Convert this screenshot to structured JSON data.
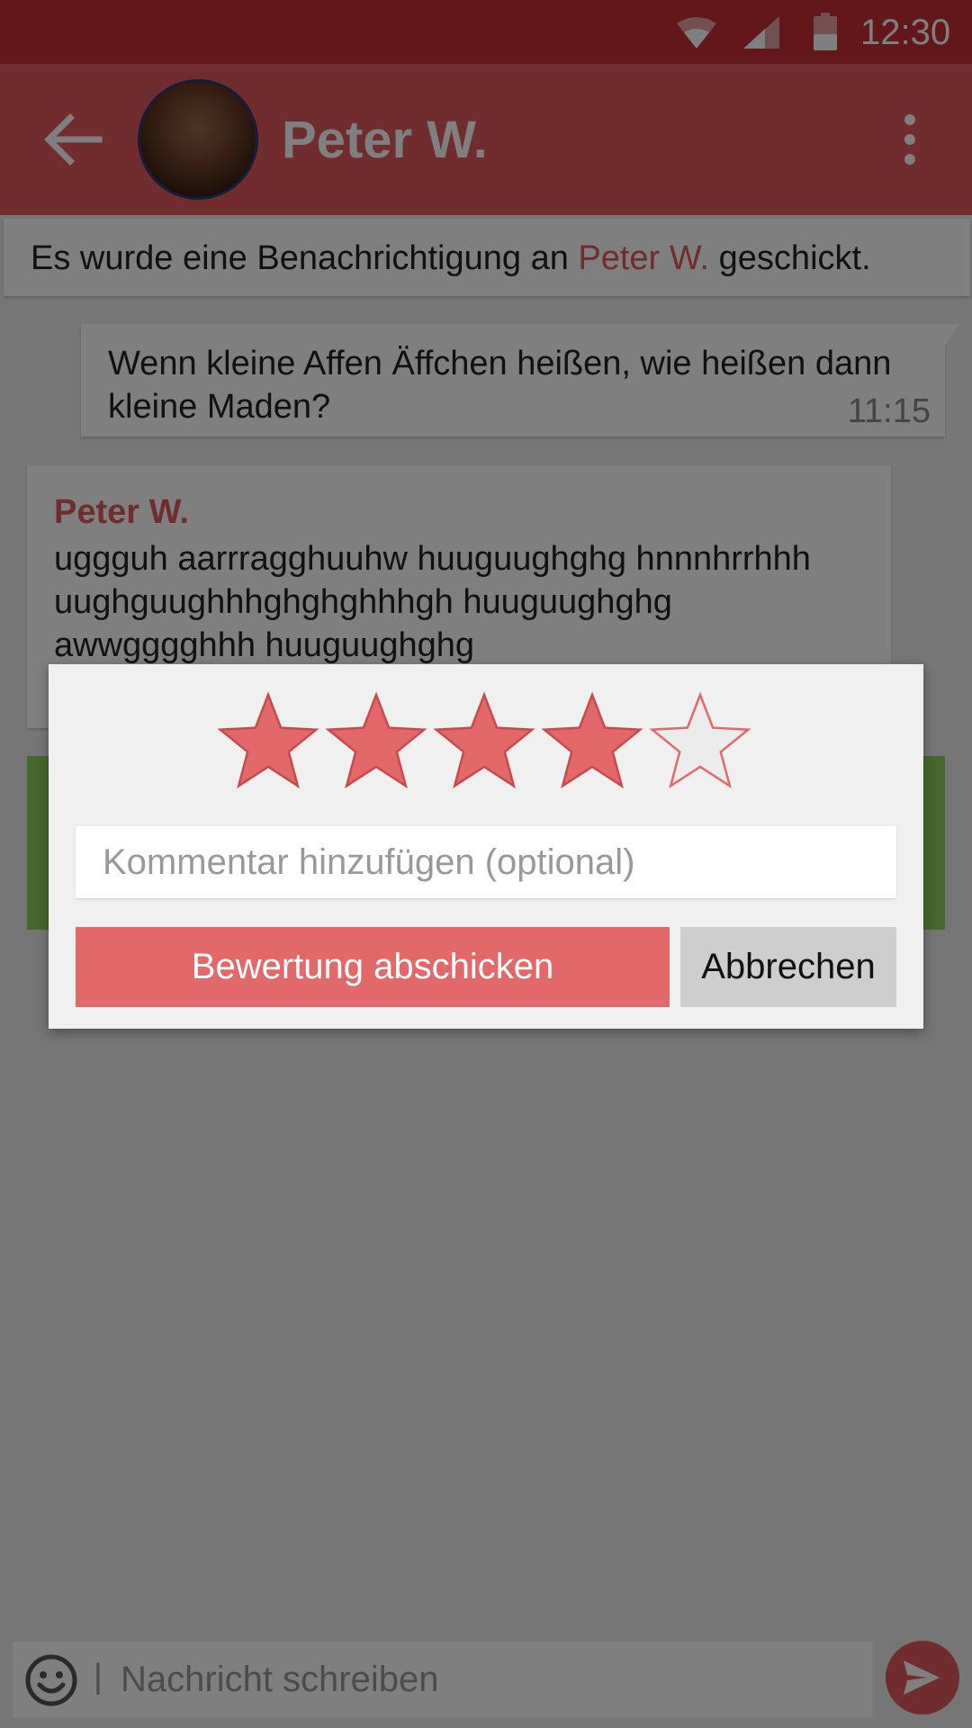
{
  "status_bar": {
    "time": "12:30",
    "icons": [
      "wifi-icon",
      "signal-icon",
      "battery-icon"
    ]
  },
  "app_bar": {
    "title": "Peter W.",
    "back_icon": "arrow-back-icon",
    "menu_icon": "more-vert-icon"
  },
  "notice": {
    "prefix": "Es wurde eine Benachrichtigung an ",
    "name": "Peter W.",
    "suffix": " geschickt."
  },
  "messages": {
    "outgoing": {
      "text": "Wenn kleine Affen Äffchen heißen, wie heißen dann kleine Maden?",
      "time": "11:15"
    },
    "incoming": {
      "sender": "Peter W.",
      "text": "uggguh aarrragghuuhw huuguughghg hnnnhrrhhh uughguughhhghghghhhgh huuguughghg awwgggghhh huuguughghg"
    }
  },
  "composer": {
    "placeholder": "Nachricht schreiben",
    "cursor": "|"
  },
  "rating_dialog": {
    "rating": 4,
    "max_rating": 5,
    "comment_placeholder": "Kommentar hinzufügen (optional)",
    "submit_label": "Bewertung abschicken",
    "cancel_label": "Abbrechen"
  },
  "colors": {
    "primary": "#e2585b",
    "status_bar": "#c62e31",
    "green_card": "#8bd05c",
    "star_filled": "#e2686a"
  }
}
